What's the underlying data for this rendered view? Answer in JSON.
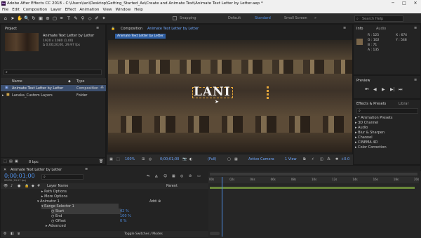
{
  "app": {
    "title": "Adobe After Effects CC 2018 - C:\\Users\\ian\\Desktop\\Getting_Started_Ae\\Create and Animate Text\\Animate Text Letter by Letter.aep *"
  },
  "menu": [
    "File",
    "Edit",
    "Composition",
    "Layer",
    "Effect",
    "Animation",
    "View",
    "Window",
    "Help"
  ],
  "toolbar": {
    "snapping": "Snapping",
    "workspaces": [
      "Default",
      "Standard",
      "Small Screen"
    ],
    "active_ws": "Standard",
    "search": "Search Help"
  },
  "project": {
    "tab": "Project",
    "item_name": "Animate Text Letter by Letter",
    "item_dims": "1920 x 1080 (1.00)",
    "item_dur": "Δ 0;00;20;00, 29.97 fps",
    "col_name": "Name",
    "col_type": "Type",
    "items": [
      {
        "name": "Animate Text Letter by Letter",
        "type": "Composition"
      },
      {
        "name": "Lanaka_Custom Layers",
        "type": "Folder"
      }
    ],
    "bpc": "8 bpc"
  },
  "comp": {
    "tab_prefix": "Composition",
    "tab_name": "Animate Text Letter by Letter",
    "sub_tab": "Animate Text Letter by Letter",
    "text": "LANI",
    "zoom": "100%",
    "timecode": "0;00;01;00",
    "res": "(Full)",
    "camera": "Active Camera",
    "view": "1 View",
    "offset": "+0.0"
  },
  "info": {
    "tab": "Info",
    "tab2": "Audio",
    "r": "R : 125",
    "g": "G : 102",
    "b": "B : 71",
    "a": "A : 135",
    "x": "X : 674",
    "y": "Y : 548",
    "color": "#7a664a"
  },
  "preview": {
    "tab": "Preview"
  },
  "effects": {
    "tab": "Effects & Presets",
    "tab2": "Librar",
    "items": [
      "* Animation Presets",
      "3D Channel",
      "Audio",
      "Blur & Sharpen",
      "Channel",
      "CINEMA 4D",
      "Color Correction"
    ]
  },
  "timeline": {
    "tab": "Animate Text Letter by Letter",
    "timecode": "0;00;01;00",
    "fps": "00030 (29.97 fps)",
    "col_layer": "Layer Name",
    "col_parent": "Parent",
    "rows": [
      {
        "label": "Path Options",
        "indent": 1
      },
      {
        "label": "More Options",
        "indent": 1
      },
      {
        "label": "Animator 1",
        "indent": 1,
        "extra": "Add:"
      },
      {
        "label": "Range Selector 1",
        "indent": 2
      },
      {
        "label": "Start",
        "indent": 3,
        "value": "42 %"
      },
      {
        "label": "End",
        "indent": 3,
        "value": "100 %"
      },
      {
        "label": "Offset",
        "indent": 3,
        "value": "0 %"
      },
      {
        "label": "Advanced",
        "indent": 2
      }
    ],
    "ticks": [
      "00s",
      "02s",
      "04s",
      "06s",
      "08s",
      "10s",
      "12s",
      "14s",
      "16s",
      "18s",
      "20s"
    ],
    "toggle": "Toggle Switches / Modes",
    "playhead_sec": 1
  }
}
